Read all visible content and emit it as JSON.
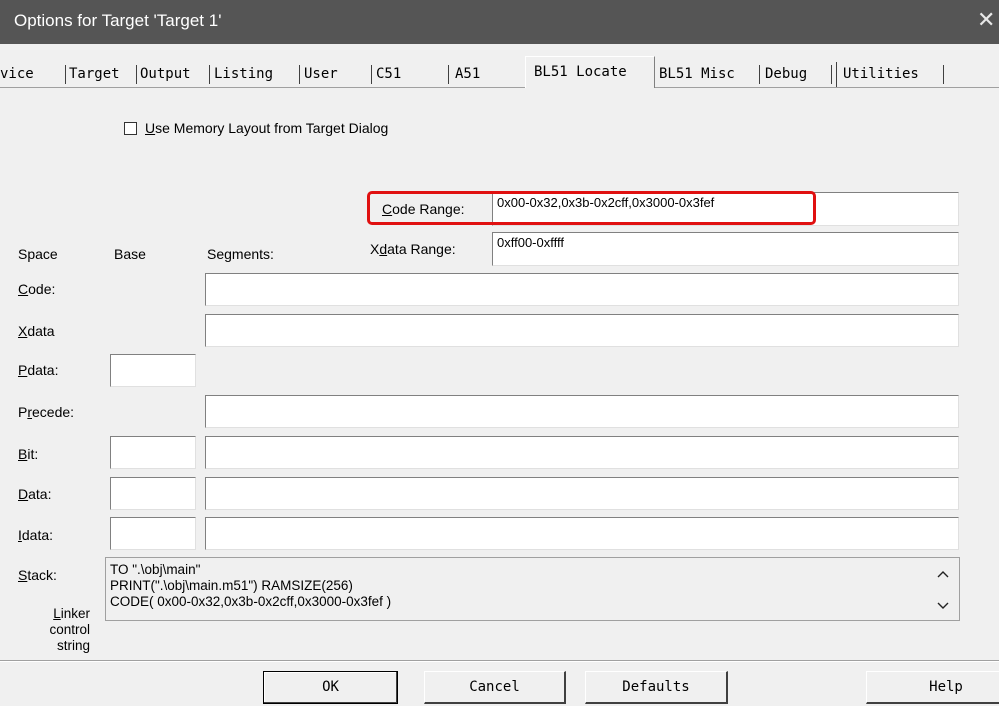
{
  "window": {
    "title": "Options for Target 'Target 1'",
    "close_glyph": "✕"
  },
  "tabs": [
    {
      "label": "vice"
    },
    {
      "label": "Target"
    },
    {
      "label": "Output"
    },
    {
      "label": "Listing"
    },
    {
      "label": "User"
    },
    {
      "label": "C51"
    },
    {
      "label": "A51"
    },
    {
      "label": "BL51 Locate",
      "active": true
    },
    {
      "label": "BL51 Misc"
    },
    {
      "label": "Debug"
    },
    {
      "label": "Utilities"
    }
  ],
  "use_memory_layout": {
    "checked": false,
    "label_u": "U",
    "label_rest": "se Memory Layout from Target Dialog"
  },
  "code_range": {
    "label_pre": "",
    "label_u": "C",
    "label_post": "ode Range:",
    "value": "0x00-0x32,0x3b-0x2cff,0x3000-0x3fef"
  },
  "xdata_range": {
    "label_pre": "X",
    "label_u": "d",
    "label_post": "ata Range:",
    "value": "0xff00-0xffff"
  },
  "columns": {
    "space": "Space",
    "base": "Base",
    "segments": "Segments:"
  },
  "rows": {
    "code": {
      "label_u": "C",
      "label_rest": "ode:",
      "base": "",
      "segments": ""
    },
    "xdata": {
      "label_u": "X",
      "label_rest": "data",
      "base": "",
      "segments": ""
    },
    "pdata": {
      "label_u": "P",
      "label_rest": "data:",
      "base": ""
    },
    "precede": {
      "label_pre": "P",
      "label_u": "r",
      "label_rest": "ecede:",
      "segments": ""
    },
    "bit": {
      "label_u": "B",
      "label_rest": "it:",
      "base": "",
      "segments": ""
    },
    "data": {
      "label_u": "D",
      "label_rest": "ata:",
      "base": "",
      "segments": ""
    },
    "idata": {
      "label_u": "I",
      "label_rest": "data:",
      "base": "",
      "segments": ""
    },
    "stack": {
      "label_u": "S",
      "label_rest": "tack:",
      "segments": ""
    }
  },
  "linker": {
    "label_line1_u": "L",
    "label_line1_rest": "inker",
    "label_line2": "control",
    "label_line3": "string",
    "lines": [
      "TO \".\\obj\\main\"",
      "PRINT(\".\\obj\\main.m51\") RAMSIZE(256)",
      "CODE( 0x00-0x32,0x3b-0x2cff,0x3000-0x3fef )"
    ],
    "scroll_up_glyph": "^",
    "scroll_down_glyph": "v"
  },
  "buttons": {
    "ok": "OK",
    "cancel": "Cancel",
    "defaults": "Defaults",
    "help": "Help"
  },
  "colors": {
    "titlebar": "#555555",
    "dialog_bg": "#f0f0f0",
    "highlight": "#e01010"
  }
}
